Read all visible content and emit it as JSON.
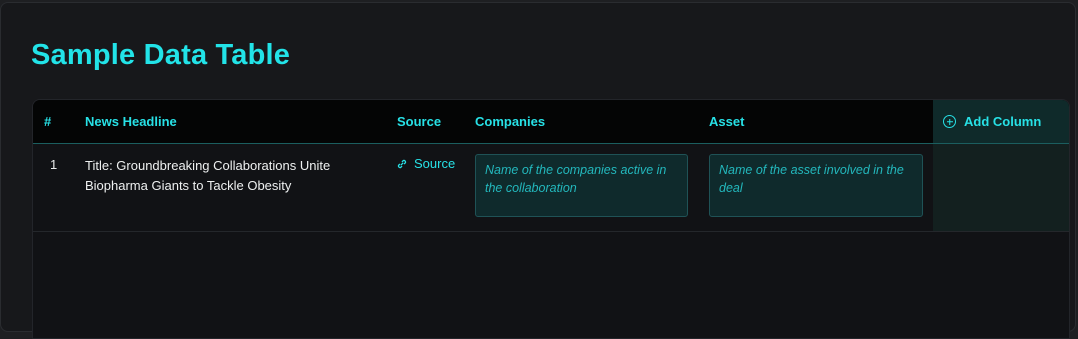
{
  "page": {
    "title": "Sample Data Table"
  },
  "table": {
    "headers": {
      "num": "#",
      "headline": "News Headline",
      "source": "Source",
      "companies": "Companies",
      "asset": "Asset",
      "add_column": "Add Column"
    },
    "rows": [
      {
        "num": "1",
        "headline": "Title: Groundbreaking Collaborations Unite Biopharma Giants to Tackle Obesity",
        "source_label": "Source",
        "companies_placeholder": "Name of the companies active in the collaboration",
        "asset_placeholder": "Name of the asset involved in the deal"
      }
    ]
  },
  "colors": {
    "accent": "#22e3e8",
    "background": "#17181b",
    "header_bg": "#040505"
  },
  "icons": {
    "source": "link-icon",
    "add_column": "plus-circle-icon"
  }
}
